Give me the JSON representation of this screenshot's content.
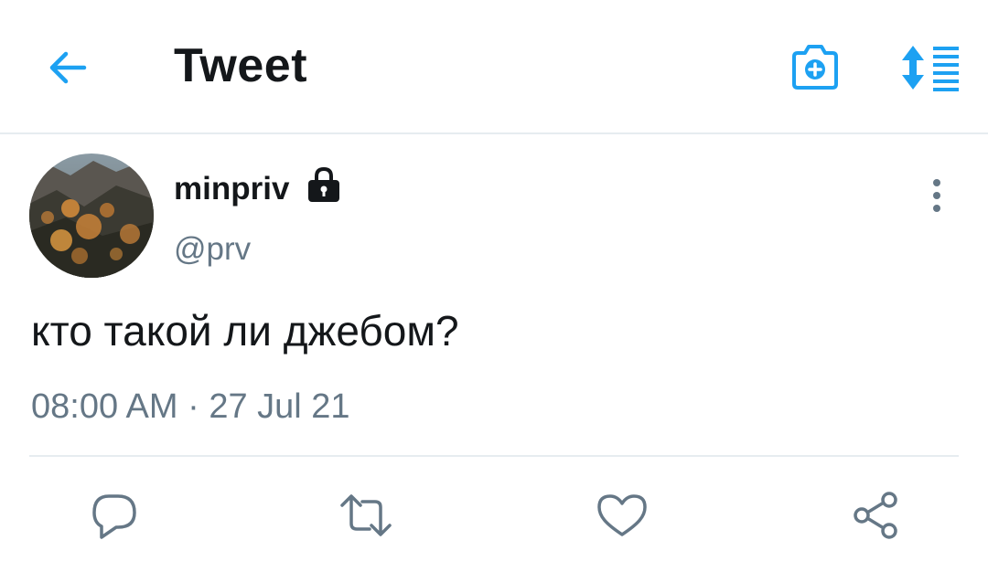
{
  "header": {
    "title": "Tweet",
    "back_icon": "arrow-left-icon",
    "camera_icon": "camera-plus-icon",
    "sort_icon": "sort-lines-icon"
  },
  "tweet": {
    "author_name": "minpriv",
    "protected_icon": "lock-icon",
    "handle": "@prv",
    "text": "кто такой ли джебом?",
    "timestamp": "08:00 AM · 27 Jul 21",
    "more_icon": "more-vertical-icon"
  },
  "actions": [
    {
      "icon": "reply-icon"
    },
    {
      "icon": "retweet-icon"
    },
    {
      "icon": "like-icon"
    },
    {
      "icon": "share-icon"
    }
  ],
  "colors": {
    "accent": "#1da1f2",
    "text_primary": "#14171a",
    "text_secondary": "#657786",
    "icon_gray": "#657786",
    "divider": "#e6ecf0"
  }
}
